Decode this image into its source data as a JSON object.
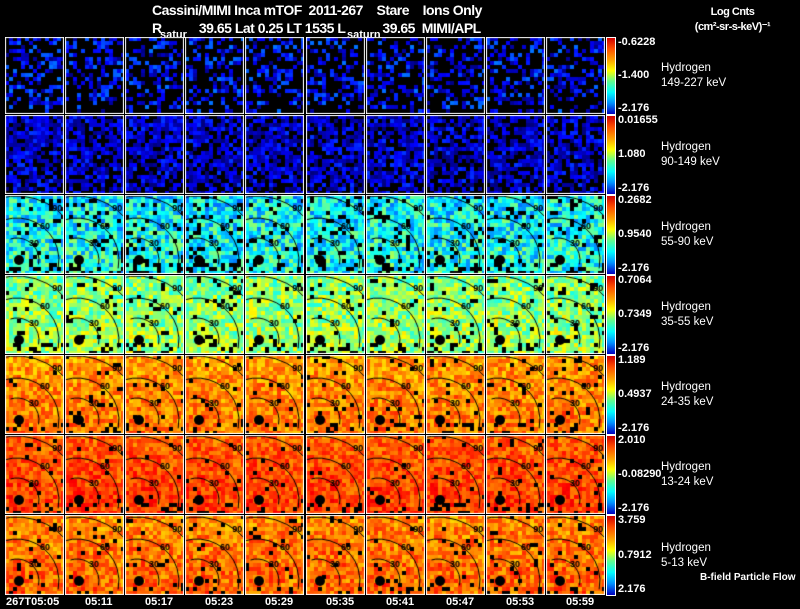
{
  "header": {
    "title_line1": "Cassini/MIMI Inca mTOF  2011-267    Stare    Ions Only",
    "title_line2": "R           39.65 Lat 0.25 LT 1535 L           39.65  MIMI/APL",
    "units_line1": "Log Cnts",
    "units_line2": "(cm²-sr-s-keV)⁻¹",
    "saturn_labels": [
      "satur",
      "saturn"
    ]
  },
  "footer": "B-field Particle Flow",
  "chart_data": {
    "type": "heatmap",
    "title": "Cassini/MIMI Inca mTOF  2011-267    Stare    Ions Only",
    "colorbar_label": "Log Cnts (cm²-sr-s-keV)⁻¹",
    "time_ticks": [
      "267T05:05",
      "05:11",
      "05:17",
      "05:23",
      "05:29",
      "05:35",
      "05:41",
      "05:47",
      "05:53",
      "05:59"
    ],
    "contour_labels": [
      "30",
      "60",
      "90"
    ],
    "rows": [
      {
        "species": "Hydrogen",
        "energy": "149-227 keV",
        "cmax": "-0.6228",
        "cmid": "-1.400",
        "cmin": "-2.176"
      },
      {
        "species": "Hydrogen",
        "energy": "90-149 keV",
        "cmax": "0.01655",
        "cmid": "1.080",
        "cmin": "-2.176"
      },
      {
        "species": "Hydrogen",
        "energy": "55-90 keV",
        "cmax": "0.2682",
        "cmid": "0.9540",
        "cmin": "-2.176"
      },
      {
        "species": "Hydrogen",
        "energy": "35-55 keV",
        "cmax": "0.7064",
        "cmid": "0.7349",
        "cmin": "-2.176"
      },
      {
        "species": "Hydrogen",
        "energy": "24-35 keV",
        "cmax": "1.189",
        "cmid": "0.4937",
        "cmin": "-2.176"
      },
      {
        "species": "Hydrogen",
        "energy": "13-24 keV",
        "cmax": "2.010",
        "cmid": "-0.08290",
        "cmin": "-2.176"
      },
      {
        "species": "Hydrogen",
        "energy": "5-13 keV",
        "cmax": "3.759",
        "cmid": "0.7912",
        "cmin": "2.176"
      }
    ]
  }
}
